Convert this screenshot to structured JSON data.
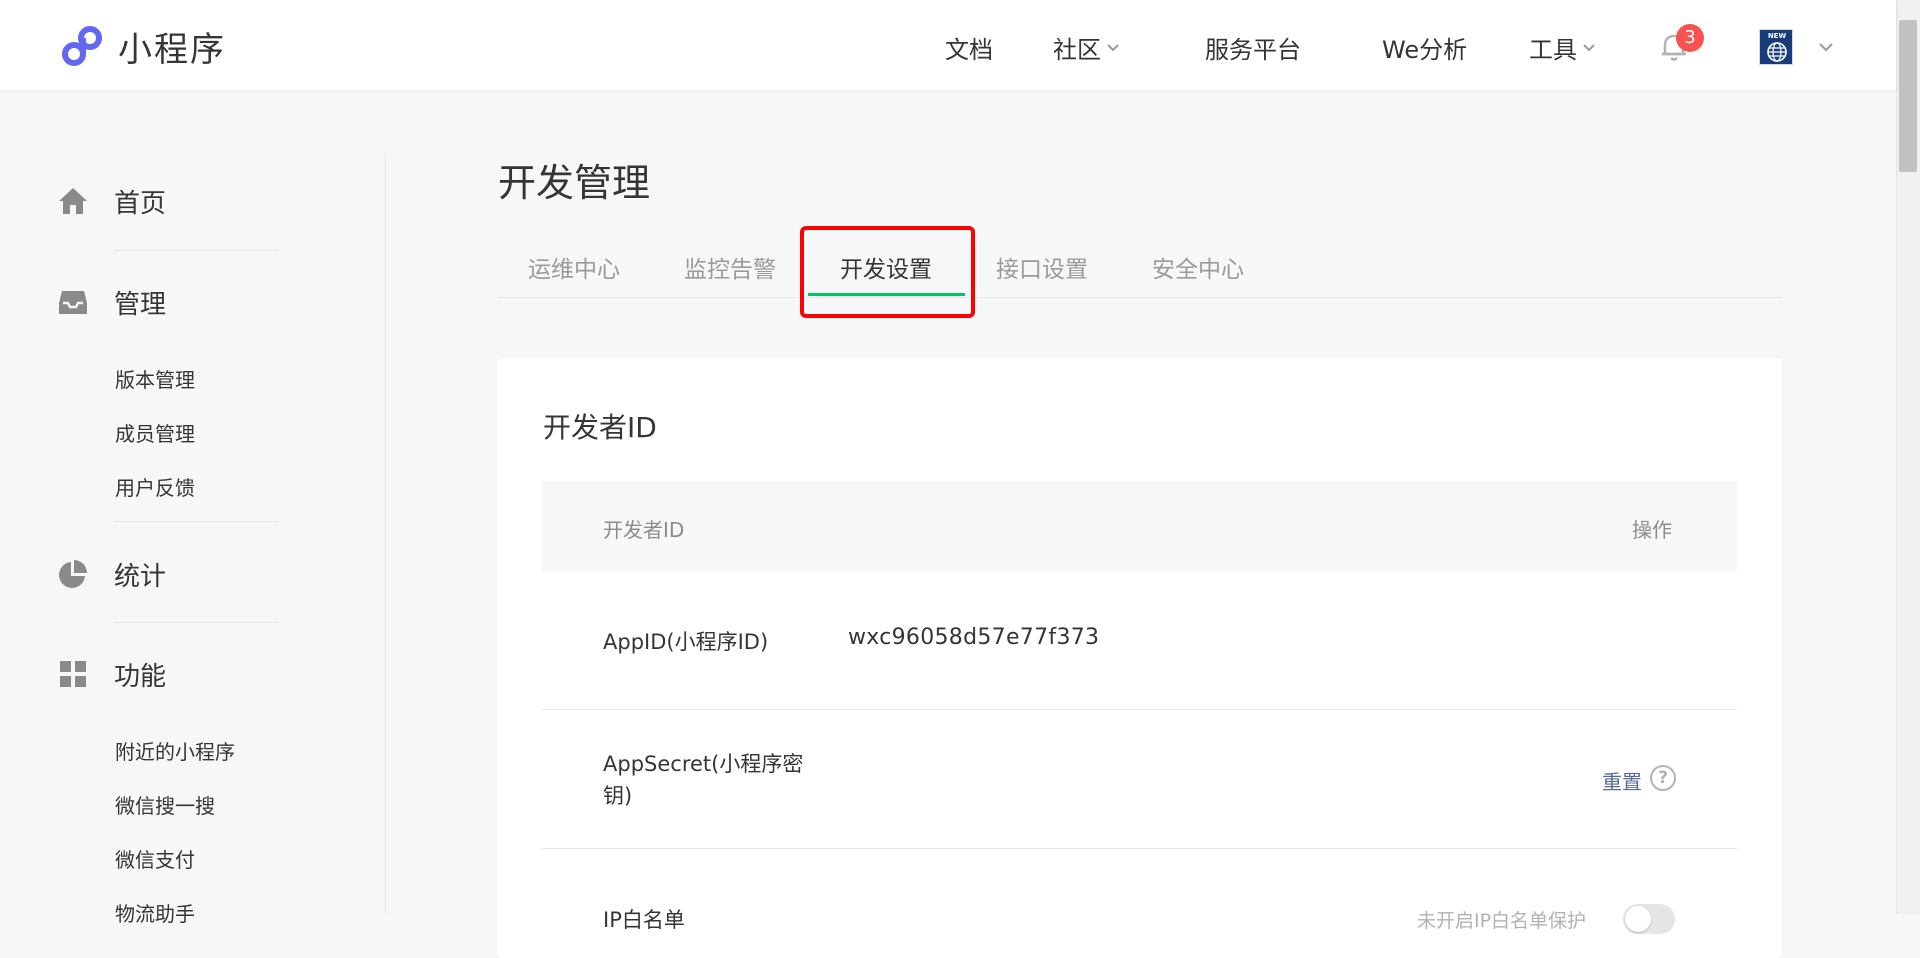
{
  "header": {
    "logo_text": "小程序",
    "nav": [
      {
        "label": "文档",
        "has_dropdown": false
      },
      {
        "label": "社区",
        "has_dropdown": true
      },
      {
        "label": "服务平台",
        "has_dropdown": false
      },
      {
        "label": "We分析",
        "has_dropdown": false
      },
      {
        "label": "工具",
        "has_dropdown": true
      }
    ],
    "notification_count": "3",
    "avatar_badge": "NEW",
    "brand_color": "#6467f0"
  },
  "sidebar": {
    "sections": [
      {
        "label": "首页",
        "icon": "home-icon"
      },
      {
        "label": "管理",
        "icon": "inbox-icon",
        "items": [
          "版本管理",
          "成员管理",
          "用户反馈"
        ]
      },
      {
        "label": "统计",
        "icon": "pie-chart-icon"
      },
      {
        "label": "功能",
        "icon": "grid-icon",
        "items": [
          "附近的小程序",
          "微信搜一搜",
          "微信支付",
          "物流助手"
        ]
      }
    ]
  },
  "main": {
    "title": "开发管理",
    "tabs": [
      "运维中心",
      "监控告警",
      "开发设置",
      "接口设置",
      "安全中心"
    ],
    "active_tab": "开发设置",
    "accent_color": "#07c160",
    "card": {
      "title": "开发者ID",
      "columns": [
        "开发者ID",
        "操作"
      ],
      "rows": [
        {
          "label": "AppID(小程序ID)",
          "value": "wxc96058d57e77f373"
        },
        {
          "label_line1": "AppSecret(小程序密",
          "label_line2": "钥)",
          "action": "重置",
          "help": "?"
        },
        {
          "label": "IP白名单",
          "action_text": "未开启IP白名单保护"
        }
      ]
    }
  }
}
